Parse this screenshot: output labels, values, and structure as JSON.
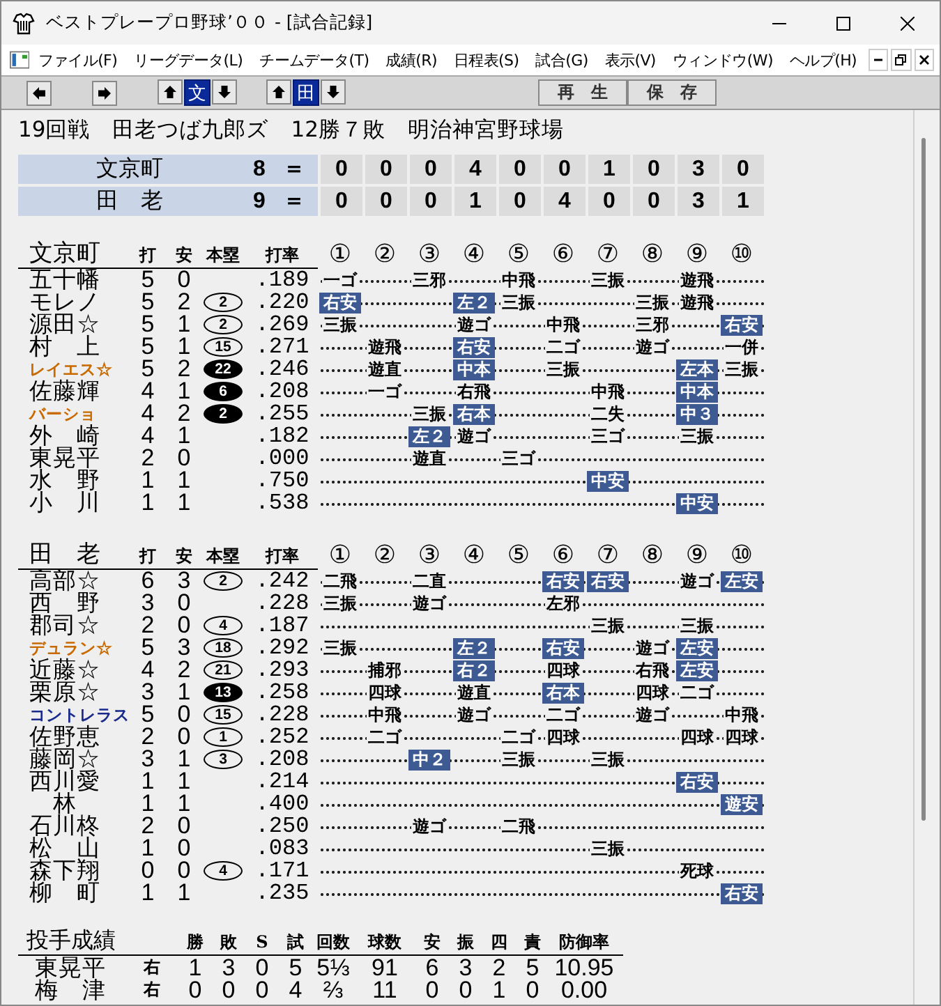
{
  "window": {
    "title": "ベストプレープロ野球’００ - [試合記録]"
  },
  "menu": [
    "ファイル(F)",
    "リーグデータ(L)",
    "チームデータ(T)",
    "成績(R)",
    "日程表(S)",
    "試合(G)",
    "表示(V)",
    "ウィンドウ(W)",
    "ヘルプ(H)"
  ],
  "toolbar": {
    "nav": [
      {
        "kind": "left"
      },
      {
        "kind": "right"
      }
    ],
    "team_selectors": [
      {
        "label": "文",
        "selected": true
      },
      {
        "label": "田",
        "selected": true
      }
    ],
    "buttons": [
      "再　生",
      "保　存"
    ]
  },
  "info": "19回戦　田老つば九郎ズ　12勝７敗　明治神宮野球場",
  "scoreboard": [
    {
      "team": "文京町",
      "total": "8",
      "equals": "＝",
      "innings": [
        "0",
        "0",
        "0",
        "4",
        "0",
        "0",
        "1",
        "0",
        "3",
        "0"
      ]
    },
    {
      "team": "田　老",
      "total": "9",
      "equals": "＝",
      "innings": [
        "0",
        "0",
        "0",
        "1",
        "0",
        "4",
        "0",
        "0",
        "3",
        "1"
      ]
    }
  ],
  "batting": [
    {
      "team": "文京町",
      "columns": [
        "打",
        "安",
        "本塁",
        "打率"
      ],
      "innings": [
        "①",
        "②",
        "③",
        "④",
        "⑤",
        "⑥",
        "⑦",
        "⑧",
        "⑨",
        "⑩"
      ],
      "rows": [
        {
          "name": "五十幡",
          "kind": "regular",
          "color": "#000000",
          "ab": "5",
          "h": "0",
          "avg": ".189",
          "slots": [
            {
              "kind": "play",
              "result": "一ゴ",
              "hit": false
            },
            {
              "kind": "gap"
            },
            {
              "kind": "play",
              "result": "三邪",
              "hit": false
            },
            {
              "kind": "gap"
            },
            {
              "kind": "play",
              "result": "中飛",
              "hit": false
            },
            {
              "kind": "gap"
            },
            {
              "kind": "play",
              "result": "三振",
              "hit": false
            },
            {
              "kind": "gap"
            },
            {
              "kind": "play",
              "result": "遊飛",
              "hit": false
            },
            {
              "kind": "gap"
            }
          ]
        },
        {
          "name": "モレノ",
          "kind": "regular",
          "color": "#000000",
          "ab": "5",
          "h": "2",
          "hr": {
            "count": "2",
            "kind": "outline"
          },
          "avg": ".220",
          "slots": [
            {
              "kind": "play",
              "result": "右安",
              "hit": true
            },
            {
              "kind": "gap"
            },
            {
              "kind": "gap"
            },
            {
              "kind": "play",
              "result": "左２",
              "hit": true
            },
            {
              "kind": "play",
              "result": "三振",
              "hit": false
            },
            {
              "kind": "gap"
            },
            {
              "kind": "gap"
            },
            {
              "kind": "play",
              "result": "三振",
              "hit": false
            },
            {
              "kind": "play",
              "result": "遊飛",
              "hit": false
            },
            {
              "kind": "gap"
            }
          ]
        },
        {
          "name": "源田☆",
          "kind": "regular",
          "color": "#000000",
          "ab": "5",
          "h": "1",
          "hr": {
            "count": "2",
            "kind": "outline"
          },
          "avg": ".269",
          "slots": [
            {
              "kind": "play",
              "result": "三振",
              "hit": false
            },
            {
              "kind": "gap"
            },
            {
              "kind": "gap"
            },
            {
              "kind": "play",
              "result": "遊ゴ",
              "hit": false
            },
            {
              "kind": "gap"
            },
            {
              "kind": "play",
              "result": "中飛",
              "hit": false
            },
            {
              "kind": "gap"
            },
            {
              "kind": "play",
              "result": "三邪",
              "hit": false
            },
            {
              "kind": "gap"
            },
            {
              "kind": "play",
              "result": "右安",
              "hit": true
            }
          ]
        },
        {
          "name": "村　上",
          "kind": "regular",
          "color": "#000000",
          "ab": "5",
          "h": "1",
          "hr": {
            "count": "15",
            "kind": "outline"
          },
          "avg": ".271",
          "slots": [
            {
              "kind": "gap"
            },
            {
              "kind": "play",
              "result": "遊飛",
              "hit": false
            },
            {
              "kind": "gap"
            },
            {
              "kind": "play",
              "result": "右安",
              "hit": true
            },
            {
              "kind": "gap"
            },
            {
              "kind": "play",
              "result": "二ゴ",
              "hit": false
            },
            {
              "kind": "gap"
            },
            {
              "kind": "play",
              "result": "遊ゴ",
              "hit": false
            },
            {
              "kind": "gap"
            },
            {
              "kind": "play",
              "result": "一併",
              "hit": false
            }
          ]
        },
        {
          "name": "レイエス☆",
          "kind": "import",
          "color": "#c86a00",
          "ab": "5",
          "h": "2",
          "hr": {
            "count": "22",
            "kind": "filled"
          },
          "avg": ".246",
          "slots": [
            {
              "kind": "gap"
            },
            {
              "kind": "play",
              "result": "遊直",
              "hit": false
            },
            {
              "kind": "gap"
            },
            {
              "kind": "play",
              "result": "中本",
              "hit": true
            },
            {
              "kind": "gap"
            },
            {
              "kind": "play",
              "result": "三振",
              "hit": false
            },
            {
              "kind": "gap"
            },
            {
              "kind": "gap"
            },
            {
              "kind": "play",
              "result": "左本",
              "hit": true
            },
            {
              "kind": "play",
              "result": "三振",
              "hit": false
            }
          ]
        },
        {
          "name": "佐藤輝",
          "kind": "regular",
          "color": "#000000",
          "ab": "4",
          "h": "1",
          "hr": {
            "count": "6",
            "kind": "filled"
          },
          "avg": ".208",
          "slots": [
            {
              "kind": "gap"
            },
            {
              "kind": "play",
              "result": "一ゴ",
              "hit": false
            },
            {
              "kind": "gap"
            },
            {
              "kind": "play",
              "result": "右飛",
              "hit": false
            },
            {
              "kind": "gap"
            },
            {
              "kind": "gap"
            },
            {
              "kind": "play",
              "result": "中飛",
              "hit": false
            },
            {
              "kind": "gap"
            },
            {
              "kind": "play",
              "result": "中本",
              "hit": true
            },
            {
              "kind": "gap"
            }
          ]
        },
        {
          "name": "バーショ",
          "kind": "import",
          "color": "#c86a00",
          "ab": "4",
          "h": "2",
          "hr": {
            "count": "2",
            "kind": "filled"
          },
          "avg": ".255",
          "slots": [
            {
              "kind": "gap"
            },
            {
              "kind": "gap"
            },
            {
              "kind": "play",
              "result": "三振",
              "hit": false
            },
            {
              "kind": "play",
              "result": "右本",
              "hit": true
            },
            {
              "kind": "gap"
            },
            {
              "kind": "gap"
            },
            {
              "kind": "play",
              "result": "二失",
              "hit": false
            },
            {
              "kind": "gap"
            },
            {
              "kind": "play",
              "result": "中３",
              "hit": true
            },
            {
              "kind": "gap"
            }
          ]
        },
        {
          "name": "外　崎",
          "kind": "regular",
          "color": "#000000",
          "ab": "4",
          "h": "1",
          "avg": ".182",
          "slots": [
            {
              "kind": "gap"
            },
            {
              "kind": "gap"
            },
            {
              "kind": "play",
              "result": "左２",
              "hit": true
            },
            {
              "kind": "play",
              "result": "遊ゴ",
              "hit": false
            },
            {
              "kind": "gap"
            },
            {
              "kind": "gap"
            },
            {
              "kind": "play",
              "result": "三ゴ",
              "hit": false
            },
            {
              "kind": "gap"
            },
            {
              "kind": "play",
              "result": "三振",
              "hit": false
            },
            {
              "kind": "gap"
            }
          ]
        },
        {
          "name": "東晃平",
          "kind": "regular",
          "color": "#000000",
          "ab": "2",
          "h": "0",
          "avg": ".000",
          "slots": [
            {
              "kind": "gap"
            },
            {
              "kind": "gap"
            },
            {
              "kind": "play",
              "result": "遊直",
              "hit": false
            },
            {
              "kind": "gap"
            },
            {
              "kind": "play",
              "result": "三ゴ",
              "hit": false
            },
            {
              "kind": "gap"
            },
            {
              "kind": "gap"
            },
            {
              "kind": "gap"
            },
            {
              "kind": "gap"
            },
            {
              "kind": "gap"
            }
          ]
        },
        {
          "name": "水　野",
          "kind": "regular",
          "color": "#000000",
          "ab": "1",
          "h": "1",
          "avg": ".750",
          "slots": [
            {
              "kind": "gap"
            },
            {
              "kind": "gap"
            },
            {
              "kind": "gap"
            },
            {
              "kind": "gap"
            },
            {
              "kind": "gap"
            },
            {
              "kind": "gap"
            },
            {
              "kind": "play",
              "result": "中安",
              "hit": true
            },
            {
              "kind": "gap"
            },
            {
              "kind": "gap"
            },
            {
              "kind": "gap"
            }
          ]
        },
        {
          "name": "小　川",
          "kind": "regular",
          "color": "#000000",
          "ab": "1",
          "h": "1",
          "avg": ".538",
          "slots": [
            {
              "kind": "gap"
            },
            {
              "kind": "gap"
            },
            {
              "kind": "gap"
            },
            {
              "kind": "gap"
            },
            {
              "kind": "gap"
            },
            {
              "kind": "gap"
            },
            {
              "kind": "gap"
            },
            {
              "kind": "gap"
            },
            {
              "kind": "play",
              "result": "中安",
              "hit": true
            },
            {
              "kind": "gap"
            }
          ]
        }
      ]
    },
    {
      "team": "田　老",
      "columns": [
        "打",
        "安",
        "本塁",
        "打率"
      ],
      "innings": [
        "①",
        "②",
        "③",
        "④",
        "⑤",
        "⑥",
        "⑦",
        "⑧",
        "⑨",
        "⑩"
      ],
      "rows": [
        {
          "name": "高部☆",
          "kind": "regular",
          "color": "#000000",
          "ab": "6",
          "h": "3",
          "hr": {
            "count": "2",
            "kind": "outline"
          },
          "avg": ".242",
          "slots": [
            {
              "kind": "play",
              "result": "二飛",
              "hit": false
            },
            {
              "kind": "gap"
            },
            {
              "kind": "play",
              "result": "二直",
              "hit": false
            },
            {
              "kind": "gap"
            },
            {
              "kind": "gap"
            },
            {
              "kind": "play",
              "result": "右安",
              "hit": true
            },
            {
              "kind": "play",
              "result": "右安",
              "hit": true
            },
            {
              "kind": "gap"
            },
            {
              "kind": "play",
              "result": "遊ゴ",
              "hit": false
            },
            {
              "kind": "play",
              "result": "左安",
              "hit": true
            }
          ]
        },
        {
          "name": "西　野",
          "kind": "regular",
          "color": "#000000",
          "ab": "3",
          "h": "0",
          "avg": ".228",
          "slots": [
            {
              "kind": "play",
              "result": "三振",
              "hit": false
            },
            {
              "kind": "gap"
            },
            {
              "kind": "play",
              "result": "遊ゴ",
              "hit": false
            },
            {
              "kind": "gap"
            },
            {
              "kind": "gap"
            },
            {
              "kind": "play",
              "result": "左邪",
              "hit": false
            },
            {
              "kind": "gap"
            },
            {
              "kind": "gap"
            },
            {
              "kind": "gap"
            },
            {
              "kind": "gap"
            }
          ]
        },
        {
          "name": "郡司☆",
          "kind": "regular",
          "color": "#000000",
          "ab": "2",
          "h": "0",
          "hr": {
            "count": "4",
            "kind": "outline"
          },
          "avg": ".187",
          "slots": [
            {
              "kind": "gap"
            },
            {
              "kind": "gap"
            },
            {
              "kind": "gap"
            },
            {
              "kind": "gap"
            },
            {
              "kind": "gap"
            },
            {
              "kind": "gap"
            },
            {
              "kind": "play",
              "result": "三振",
              "hit": false
            },
            {
              "kind": "gap"
            },
            {
              "kind": "play",
              "result": "三振",
              "hit": false
            },
            {
              "kind": "gap"
            }
          ]
        },
        {
          "name": "デュラン☆",
          "kind": "import",
          "color": "#c86a00",
          "ab": "5",
          "h": "3",
          "hr": {
            "count": "18",
            "kind": "outline"
          },
          "avg": ".292",
          "slots": [
            {
              "kind": "play",
              "result": "三振",
              "hit": false
            },
            {
              "kind": "gap"
            },
            {
              "kind": "gap"
            },
            {
              "kind": "play",
              "result": "左２",
              "hit": true
            },
            {
              "kind": "gap"
            },
            {
              "kind": "play",
              "result": "右安",
              "hit": true
            },
            {
              "kind": "gap"
            },
            {
              "kind": "play",
              "result": "遊ゴ",
              "hit": false
            },
            {
              "kind": "play",
              "result": "左安",
              "hit": true
            },
            {
              "kind": "gap"
            }
          ]
        },
        {
          "name": "近藤☆",
          "kind": "regular",
          "color": "#000000",
          "ab": "4",
          "h": "2",
          "hr": {
            "count": "21",
            "kind": "outline"
          },
          "avg": ".293",
          "slots": [
            {
              "kind": "gap"
            },
            {
              "kind": "play",
              "result": "捕邪",
              "hit": false
            },
            {
              "kind": "gap"
            },
            {
              "kind": "play",
              "result": "右２",
              "hit": true
            },
            {
              "kind": "gap"
            },
            {
              "kind": "play",
              "result": "四球",
              "hit": false
            },
            {
              "kind": "gap"
            },
            {
              "kind": "play",
              "result": "右飛",
              "hit": false
            },
            {
              "kind": "play",
              "result": "左安",
              "hit": true
            },
            {
              "kind": "gap"
            }
          ]
        },
        {
          "name": "栗原☆",
          "kind": "regular",
          "color": "#000000",
          "ab": "3",
          "h": "1",
          "hr": {
            "count": "13",
            "kind": "filled"
          },
          "avg": ".258",
          "slots": [
            {
              "kind": "gap"
            },
            {
              "kind": "play",
              "result": "四球",
              "hit": false
            },
            {
              "kind": "gap"
            },
            {
              "kind": "play",
              "result": "遊直",
              "hit": false
            },
            {
              "kind": "gap"
            },
            {
              "kind": "play",
              "result": "右本",
              "hit": true
            },
            {
              "kind": "gap"
            },
            {
              "kind": "play",
              "result": "四球",
              "hit": false
            },
            {
              "kind": "play",
              "result": "二ゴ",
              "hit": false
            },
            {
              "kind": "gap"
            }
          ]
        },
        {
          "name": "コントレラス",
          "kind": "import",
          "color": "#1a2a8c",
          "ab": "5",
          "h": "0",
          "hr": {
            "count": "15",
            "kind": "outline"
          },
          "avg": ".228",
          "slots": [
            {
              "kind": "gap"
            },
            {
              "kind": "play",
              "result": "中飛",
              "hit": false
            },
            {
              "kind": "gap"
            },
            {
              "kind": "play",
              "result": "遊ゴ",
              "hit": false
            },
            {
              "kind": "gap"
            },
            {
              "kind": "play",
              "result": "二ゴ",
              "hit": false
            },
            {
              "kind": "gap"
            },
            {
              "kind": "play",
              "result": "遊ゴ",
              "hit": false
            },
            {
              "kind": "gap"
            },
            {
              "kind": "play",
              "result": "中飛",
              "hit": false
            }
          ]
        },
        {
          "name": "佐野恵",
          "kind": "regular",
          "color": "#000000",
          "ab": "2",
          "h": "0",
          "hr": {
            "count": "1",
            "kind": "outline"
          },
          "avg": ".252",
          "slots": [
            {
              "kind": "gap"
            },
            {
              "kind": "play",
              "result": "二ゴ",
              "hit": false
            },
            {
              "kind": "gap"
            },
            {
              "kind": "gap"
            },
            {
              "kind": "play",
              "result": "二ゴ",
              "hit": false
            },
            {
              "kind": "play",
              "result": "四球",
              "hit": false
            },
            {
              "kind": "gap"
            },
            {
              "kind": "gap"
            },
            {
              "kind": "play",
              "result": "四球",
              "hit": false
            },
            {
              "kind": "play",
              "result": "四球",
              "hit": false
            }
          ]
        },
        {
          "name": "藤岡☆",
          "kind": "regular",
          "color": "#000000",
          "ab": "3",
          "h": "1",
          "hr": {
            "count": "3",
            "kind": "outline"
          },
          "avg": ".208",
          "slots": [
            {
              "kind": "gap"
            },
            {
              "kind": "gap"
            },
            {
              "kind": "play",
              "result": "中２",
              "hit": true
            },
            {
              "kind": "gap"
            },
            {
              "kind": "play",
              "result": "三振",
              "hit": false
            },
            {
              "kind": "gap"
            },
            {
              "kind": "play",
              "result": "三振",
              "hit": false
            },
            {
              "kind": "gap"
            },
            {
              "kind": "gap"
            },
            {
              "kind": "gap"
            }
          ]
        },
        {
          "name": "西川愛",
          "kind": "regular",
          "color": "#000000",
          "ab": "1",
          "h": "1",
          "avg": ".214",
          "slots": [
            {
              "kind": "gap"
            },
            {
              "kind": "gap"
            },
            {
              "kind": "gap"
            },
            {
              "kind": "gap"
            },
            {
              "kind": "gap"
            },
            {
              "kind": "gap"
            },
            {
              "kind": "gap"
            },
            {
              "kind": "gap"
            },
            {
              "kind": "play",
              "result": "右安",
              "hit": true
            },
            {
              "kind": "gap"
            }
          ]
        },
        {
          "name": "　林",
          "kind": "regular",
          "color": "#000000",
          "ab": "1",
          "h": "1",
          "avg": ".400",
          "slots": [
            {
              "kind": "gap"
            },
            {
              "kind": "gap"
            },
            {
              "kind": "gap"
            },
            {
              "kind": "gap"
            },
            {
              "kind": "gap"
            },
            {
              "kind": "gap"
            },
            {
              "kind": "gap"
            },
            {
              "kind": "gap"
            },
            {
              "kind": "gap"
            },
            {
              "kind": "play",
              "result": "遊安",
              "hit": true
            }
          ]
        },
        {
          "name": "石川柊",
          "kind": "regular",
          "color": "#000000",
          "ab": "2",
          "h": "0",
          "avg": ".250",
          "slots": [
            {
              "kind": "gap"
            },
            {
              "kind": "gap"
            },
            {
              "kind": "play",
              "result": "遊ゴ",
              "hit": false
            },
            {
              "kind": "gap"
            },
            {
              "kind": "play",
              "result": "二飛",
              "hit": false
            },
            {
              "kind": "gap"
            },
            {
              "kind": "gap"
            },
            {
              "kind": "gap"
            },
            {
              "kind": "gap"
            },
            {
              "kind": "gap"
            }
          ]
        },
        {
          "name": "松　山",
          "kind": "regular",
          "color": "#000000",
          "ab": "1",
          "h": "0",
          "avg": ".083",
          "slots": [
            {
              "kind": "gap"
            },
            {
              "kind": "gap"
            },
            {
              "kind": "gap"
            },
            {
              "kind": "gap"
            },
            {
              "kind": "gap"
            },
            {
              "kind": "gap"
            },
            {
              "kind": "play",
              "result": "三振",
              "hit": false
            },
            {
              "kind": "gap"
            },
            {
              "kind": "gap"
            },
            {
              "kind": "gap"
            }
          ]
        },
        {
          "name": "森下翔",
          "kind": "regular",
          "color": "#000000",
          "ab": "0",
          "h": "0",
          "hr": {
            "count": "4",
            "kind": "outline"
          },
          "avg": ".171",
          "slots": [
            {
              "kind": "gap"
            },
            {
              "kind": "gap"
            },
            {
              "kind": "gap"
            },
            {
              "kind": "gap"
            },
            {
              "kind": "gap"
            },
            {
              "kind": "gap"
            },
            {
              "kind": "gap"
            },
            {
              "kind": "gap"
            },
            {
              "kind": "play",
              "result": "死球",
              "hit": false
            },
            {
              "kind": "gap"
            }
          ]
        },
        {
          "name": "柳　町",
          "kind": "regular",
          "color": "#000000",
          "ab": "1",
          "h": "1",
          "avg": ".235",
          "slots": [
            {
              "kind": "gap"
            },
            {
              "kind": "gap"
            },
            {
              "kind": "gap"
            },
            {
              "kind": "gap"
            },
            {
              "kind": "gap"
            },
            {
              "kind": "gap"
            },
            {
              "kind": "gap"
            },
            {
              "kind": "gap"
            },
            {
              "kind": "gap"
            },
            {
              "kind": "play",
              "result": "右安",
              "hit": true
            }
          ]
        }
      ]
    }
  ],
  "pitching": {
    "title": "投手成績",
    "columns": [
      "勝",
      "敗",
      "S",
      "試",
      "回数",
      "球数",
      "安",
      "振",
      "四",
      "責",
      "防御率"
    ],
    "rows": [
      {
        "name": "東晃平",
        "hand": "右",
        "values": [
          "1",
          "3",
          "0",
          "5",
          "5⅓",
          "91",
          "6",
          "3",
          "2",
          "5",
          "10.95"
        ]
      },
      {
        "name": "梅　津",
        "hand": "右",
        "values": [
          "0",
          "0",
          "0",
          "4",
          "⅔",
          "11",
          "0",
          "0",
          "1",
          "0",
          "0.00"
        ]
      }
    ]
  }
}
